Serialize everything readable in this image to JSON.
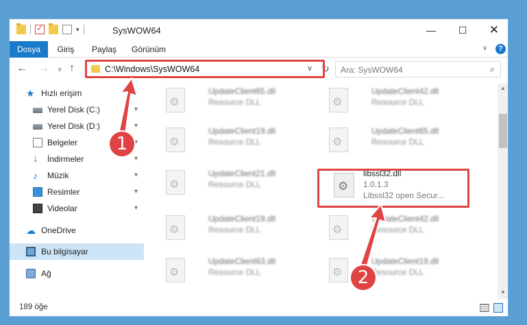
{
  "window": {
    "title": "SysWOW64",
    "minimize_label": "—",
    "maximize_label": "☐",
    "close_label": "✕"
  },
  "ribbon": {
    "tabs": [
      "Dosya",
      "Giriş",
      "Paylaş",
      "Görünüm"
    ],
    "help": "?",
    "chevron": "∨"
  },
  "address": {
    "path": "C:\\Windows\\SysWOW64",
    "dropdown": "∨",
    "refresh": "↻"
  },
  "nav_buttons": {
    "back": "←",
    "forward": "→",
    "recent": "∨",
    "up": "↑"
  },
  "search": {
    "placeholder": "Ara: SysWOW64",
    "icon": "⌕"
  },
  "sidebar": {
    "items": [
      {
        "label": "Hızlı erişim",
        "icon": "star-icon",
        "pinned": false
      },
      {
        "label": "Yerel Disk (C:)",
        "icon": "drive-icon",
        "pinned": true
      },
      {
        "label": "Yerel Disk (D:)",
        "icon": "drive-icon",
        "pinned": true
      },
      {
        "label": "Belgeler",
        "icon": "document-icon",
        "pinned": true
      },
      {
        "label": "İndirmeler",
        "icon": "download-icon",
        "pinned": true
      },
      {
        "label": "Müzik",
        "icon": "music-icon",
        "pinned": true
      },
      {
        "label": "Resimler",
        "icon": "pictures-icon",
        "pinned": true
      },
      {
        "label": "Videolar",
        "icon": "video-icon",
        "pinned": true
      },
      {
        "label": "OneDrive",
        "icon": "cloud-icon",
        "pinned": false
      },
      {
        "label": "Bu bilgisayar",
        "icon": "computer-icon",
        "pinned": false,
        "selected": true
      },
      {
        "label": "Ağ",
        "icon": "network-icon",
        "pinned": false
      }
    ],
    "pin_glyph": "📌"
  },
  "files": [
    {
      "name": "UpdateClient65.dll",
      "desc": "Resource DLL"
    },
    {
      "name": "UpdateClient42.dll",
      "desc": "Resource DLL"
    },
    {
      "name": "UpdateClient19.dll",
      "desc": "Resource DLL"
    },
    {
      "name": "UpdateClient65.dll",
      "desc": "Resource DLL"
    },
    {
      "name": "UpdateClient21.dll",
      "desc": "Resource DLL"
    },
    {
      "name": "libssl32.dll",
      "version": "1.0.1.3",
      "desc": "Libssl32 open Secur..."
    },
    {
      "name": "UpdateClient19.dll",
      "desc": "Resource DLL"
    },
    {
      "name": "UpdateClient42.dll",
      "desc": "Resource DLL"
    },
    {
      "name": "UpdateClient63.dll",
      "desc": "Resource DLL"
    },
    {
      "name": "UpdateClient19.dll",
      "desc": "Resource DLL"
    }
  ],
  "status": {
    "count": "189 öğe"
  },
  "annotations": {
    "step1": "1",
    "step2": "2",
    "color": "#e04343"
  }
}
